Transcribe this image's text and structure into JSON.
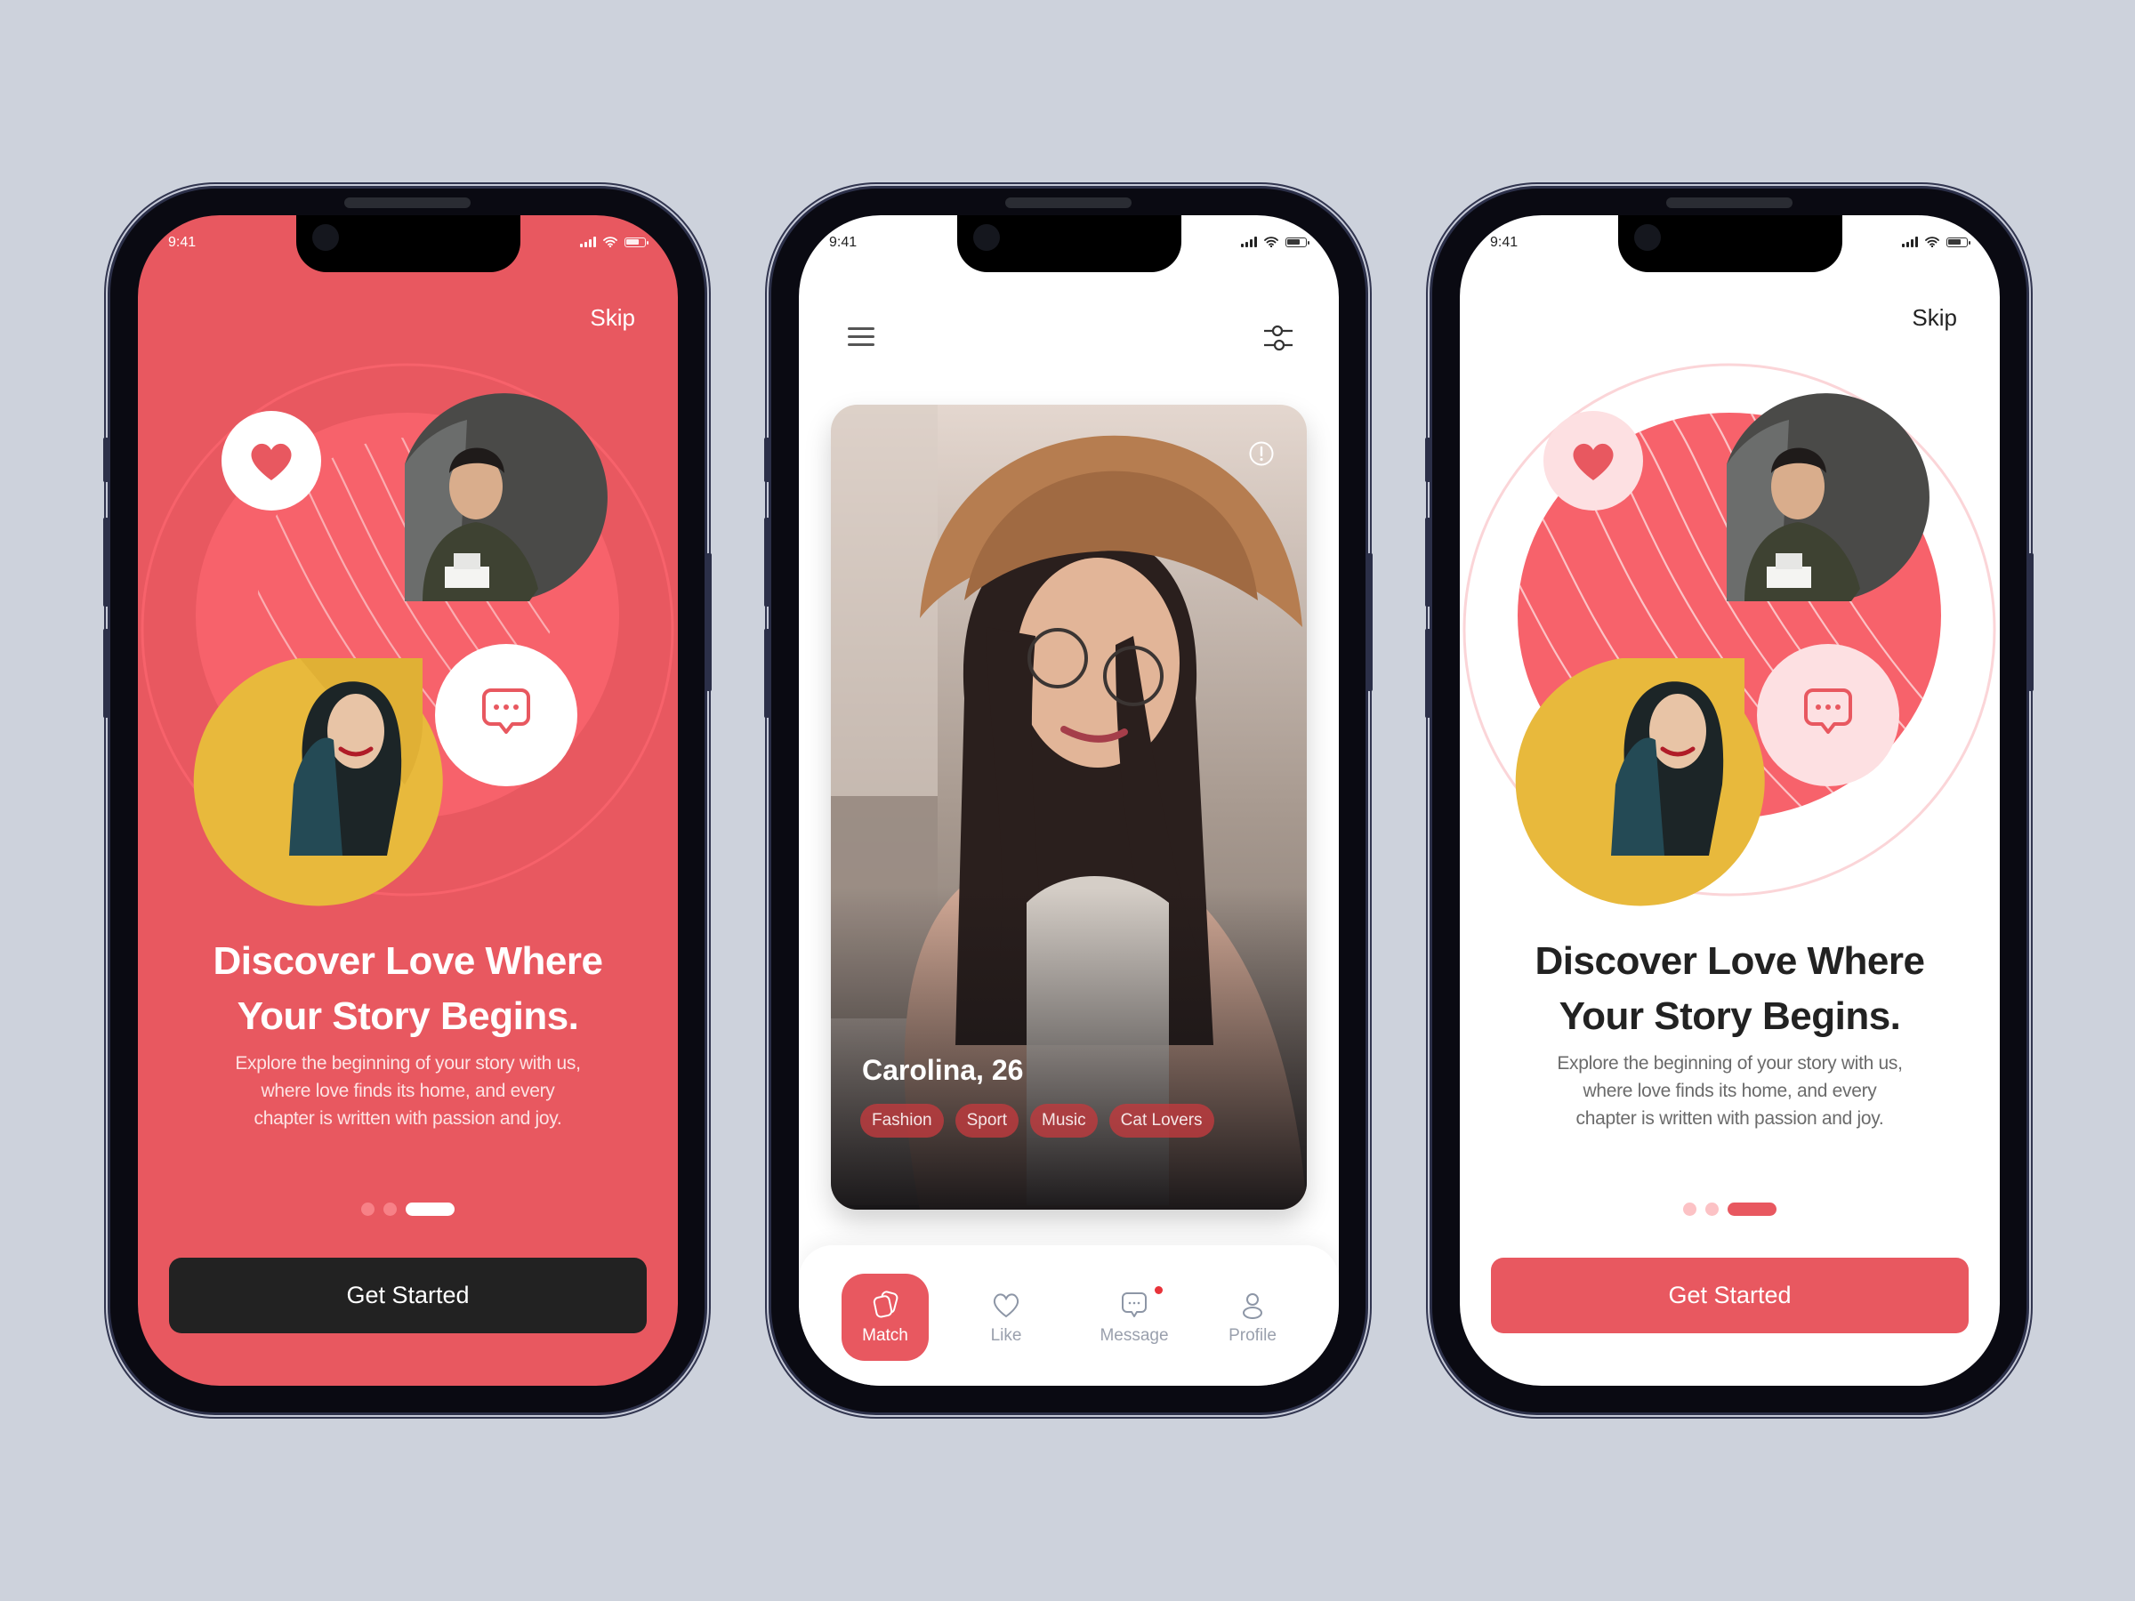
{
  "colors": {
    "background": "#cdd2dc",
    "brand": "#e85860",
    "brand_light": "#f7626b",
    "pink_soft": "#fde0e2",
    "dark_button": "#222222",
    "white": "#ffffff",
    "text_dark": "#222222",
    "text_gray": "#6b6b6b",
    "tab_inactive": "#9aa0ad",
    "notification_dot": "#e8333a"
  },
  "status_bar": {
    "time": "9:41"
  },
  "onboarding_red": {
    "skip_label": "Skip",
    "title_line1": "Discover Love Where",
    "title_line2": "Your Story Begins.",
    "description_line1": "Explore the beginning of your story with us,",
    "description_line2": "where love finds its home, and every",
    "description_line3": "chapter is written with passion and joy.",
    "page_indicator": {
      "total": 3,
      "active_index": 2
    },
    "cta_label": "Get Started",
    "heart_icon": "heart-icon",
    "chat_icon": "chat-bubble-icon"
  },
  "match_screen": {
    "menu_icon": "hamburger-menu-icon",
    "filter_icon": "sliders-filter-icon",
    "profile": {
      "name_age": "Carolina, 26",
      "tags": [
        "Fashion",
        "Sport",
        "Music",
        "Cat Lovers"
      ],
      "info_icon": "info-icon"
    },
    "tabs": [
      {
        "label": "Match",
        "icon": "cards-icon",
        "active": true,
        "badge": false
      },
      {
        "label": "Like",
        "icon": "heart-outline-icon",
        "active": false,
        "badge": false
      },
      {
        "label": "Message",
        "icon": "chat-bubble-icon",
        "active": false,
        "badge": true
      },
      {
        "label": "Profile",
        "icon": "user-icon",
        "active": false,
        "badge": false
      }
    ]
  },
  "onboarding_white": {
    "skip_label": "Skip",
    "title_line1": "Discover Love Where",
    "title_line2": "Your Story Begins.",
    "description_line1": "Explore the beginning of your story with us,",
    "description_line2": "where love finds its home, and every",
    "description_line3": "chapter is written with passion and joy.",
    "page_indicator": {
      "total": 3,
      "active_index": 2
    },
    "cta_label": "Get Started"
  }
}
